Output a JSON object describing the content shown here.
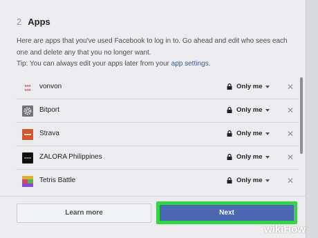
{
  "header": {
    "step_number": "2",
    "title": "Apps"
  },
  "description": "Here are apps that you've used Facebook to log in to. Go ahead and edit who sees each one and delete any that you no longer want.",
  "tip": {
    "prefix": "Tip: You can always edit your apps later from your ",
    "link": "app settings",
    "suffix": "."
  },
  "apps": [
    {
      "name": "vonvon",
      "privacy": "Only me",
      "icon": "vonvon-logo-icon"
    },
    {
      "name": "Bitport",
      "privacy": "Only me",
      "icon": "bitport-gear-icon"
    },
    {
      "name": "Strava",
      "privacy": "Only me",
      "icon": "strava-logo-icon"
    },
    {
      "name": "ZALORA Philippines",
      "privacy": "Only me",
      "icon": "zalora-logo-icon"
    },
    {
      "name": "Tetris Battle",
      "privacy": "Only me",
      "icon": "tetris-logo-icon"
    }
  ],
  "footer": {
    "learn_more": "Learn more",
    "next": "Next"
  },
  "colors": {
    "accent": "#4c66b0",
    "highlight": "#31d643",
    "link": "#3b5998"
  },
  "watermark": {
    "wiki": "wiki",
    "how": "How"
  }
}
